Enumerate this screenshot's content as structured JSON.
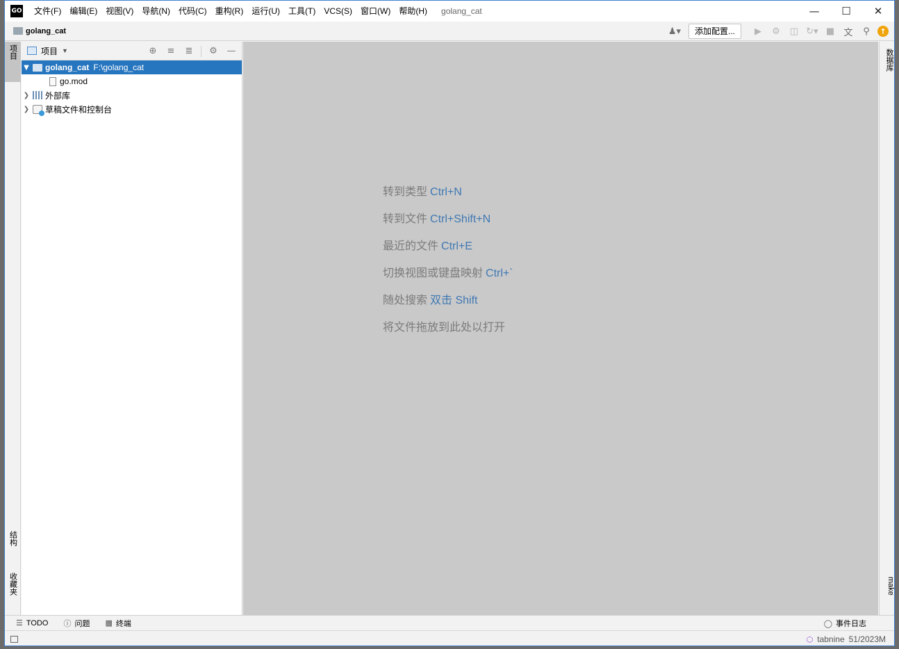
{
  "app": {
    "logo_text": "GO",
    "window_title": "golang_cat"
  },
  "menu": [
    "文件(F)",
    "编辑(E)",
    "视图(V)",
    "导航(N)",
    "代码(C)",
    "重构(R)",
    "运行(U)",
    "工具(T)",
    "VCS(S)",
    "窗口(W)",
    "帮助(H)"
  ],
  "window_controls": {
    "minimize": "—",
    "maximize": "☐",
    "close": "✕"
  },
  "navbar": {
    "project": "golang_cat",
    "add_config_label": "添加配置..."
  },
  "left_strip": {
    "project": "项目",
    "structure": "结构",
    "favorites": "收藏夹"
  },
  "right_strip": {
    "database": "数据库",
    "make": "make"
  },
  "project_panel": {
    "title": "项目",
    "tree": [
      {
        "label": "golang_cat",
        "path": "F:\\golang_cat"
      },
      {
        "label": "go.mod"
      },
      {
        "label": "外部库"
      },
      {
        "label": "草稿文件和控制台"
      }
    ]
  },
  "editor_hints": [
    {
      "text": "转到类型",
      "key": "Ctrl+N"
    },
    {
      "text": "转到文件",
      "key": "Ctrl+Shift+N"
    },
    {
      "text": "最近的文件",
      "key": "Ctrl+E"
    },
    {
      "text": "切换视图或键盘映射",
      "key": "Ctrl+`"
    },
    {
      "text": "随处搜索",
      "key": "双击 Shift"
    },
    {
      "text": "将文件拖放到此处以打开",
      "key": ""
    }
  ],
  "bottom_tools": {
    "todo": "TODO",
    "problems": "问题",
    "terminal": "终端",
    "event_log": "事件日志"
  },
  "status_bar": {
    "plugin": "tabnine",
    "memory": "51/2023M"
  },
  "colors": {
    "selection": "#2675bf",
    "editor_bg": "#c9c9c9",
    "shortcut": "#3f78b3",
    "hint_text": "#7b7b7b"
  }
}
